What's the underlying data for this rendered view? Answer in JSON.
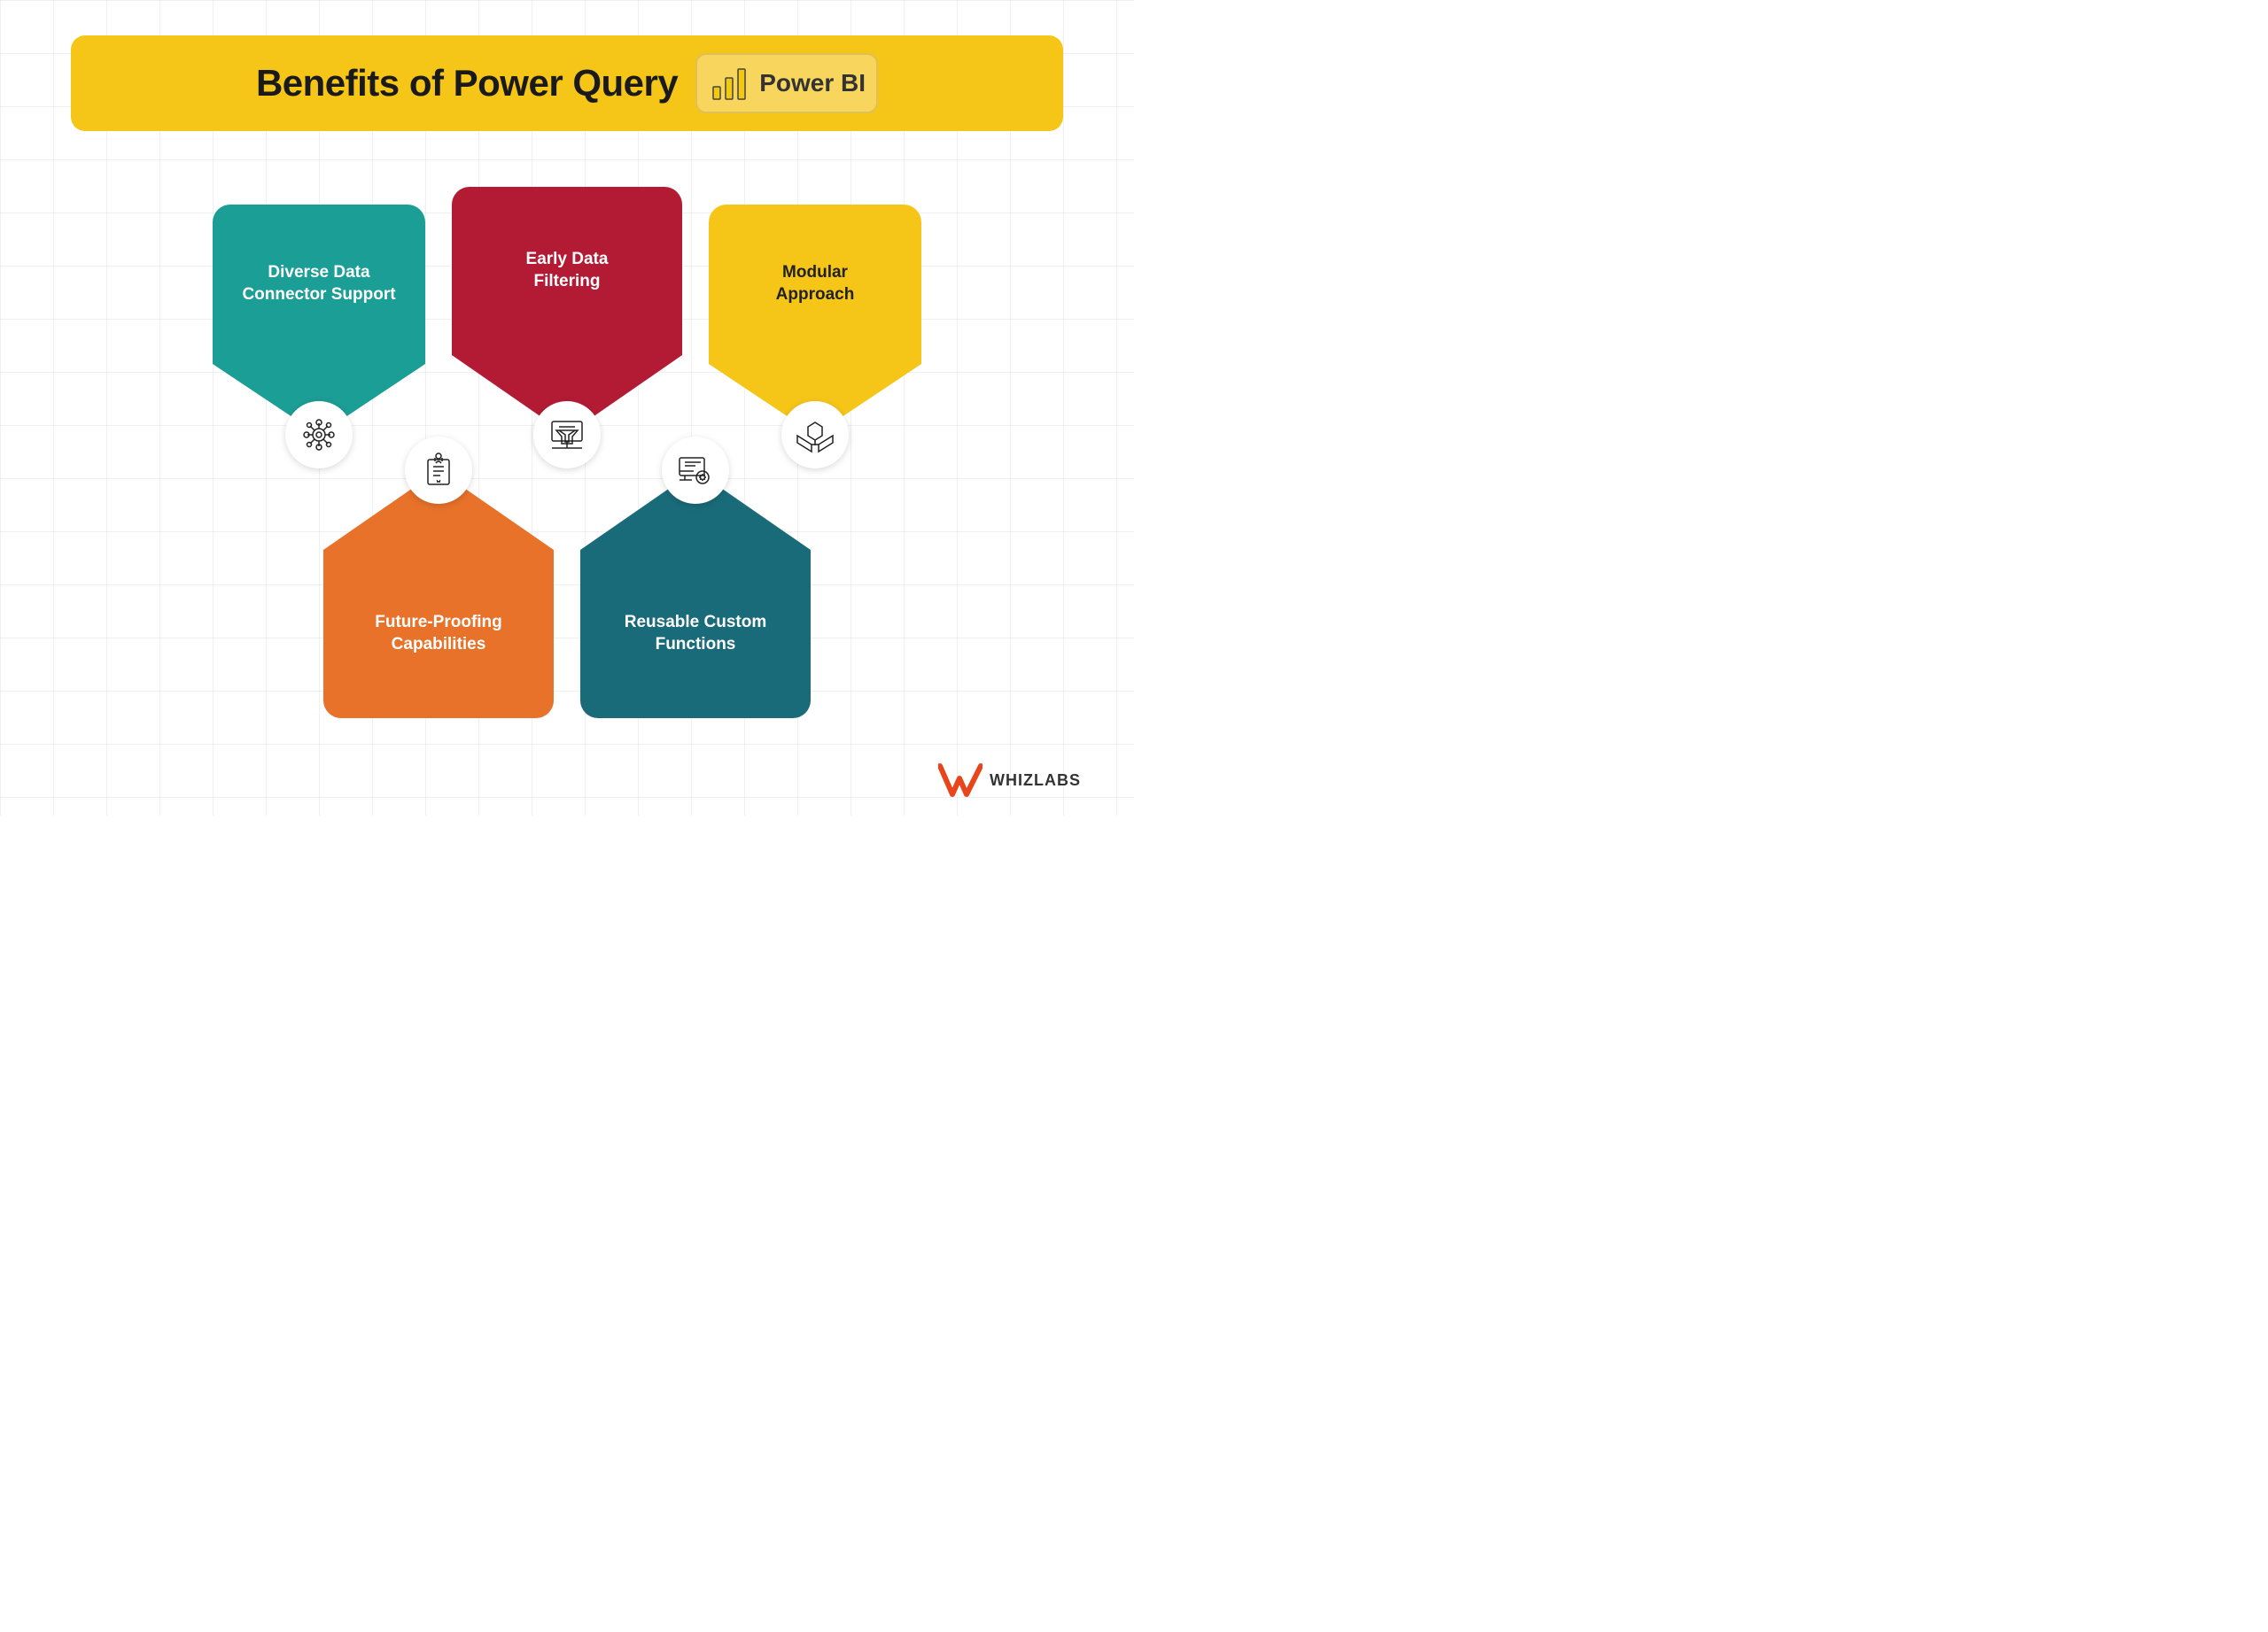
{
  "header": {
    "title": "Benefits of Power Query",
    "powerbi_label": "Power BI"
  },
  "cards": {
    "top": [
      {
        "id": "diverse-data",
        "label": "Diverse Data Connector Support",
        "color": "teal",
        "icon": "connector"
      },
      {
        "id": "early-filter",
        "label": "Early Data Filtering",
        "color": "crimson",
        "icon": "filter"
      },
      {
        "id": "modular",
        "label": "Modular Approach",
        "color": "gold",
        "icon": "modules",
        "dark_text": true
      }
    ],
    "bottom": [
      {
        "id": "future-proof",
        "label": "Future-Proofing Capabilities",
        "color": "orange",
        "icon": "checklist"
      },
      {
        "id": "reusable",
        "label": "Reusable Custom Functions",
        "color": "dark-teal",
        "icon": "functions"
      }
    ]
  },
  "footer": {
    "brand": "WHIZLABS"
  }
}
